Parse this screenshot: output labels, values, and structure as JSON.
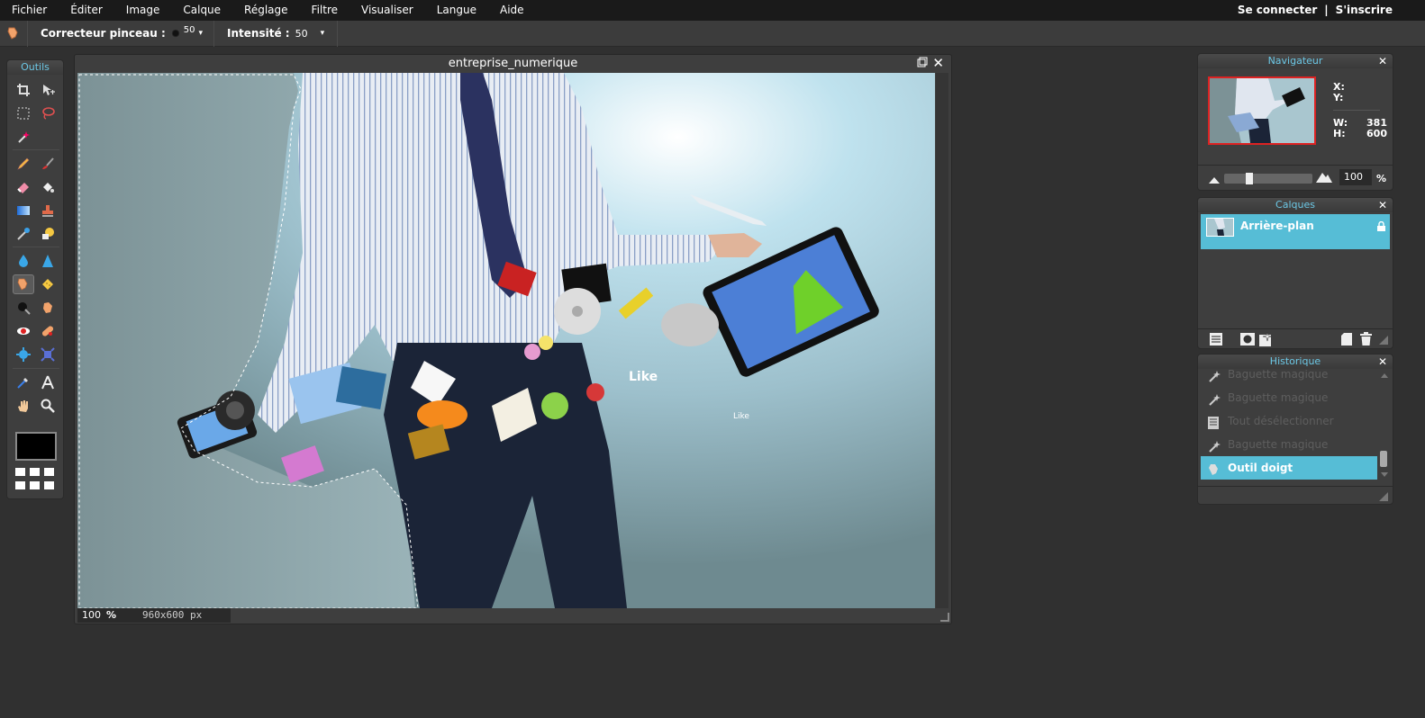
{
  "menu": {
    "items": [
      "Fichier",
      "Éditer",
      "Image",
      "Calque",
      "Réglage",
      "Filtre",
      "Visualiser",
      "Langue",
      "Aide"
    ],
    "login": "Se connecter",
    "separator": "|",
    "signup": "S'inscrire"
  },
  "options": {
    "tool_icon": "smudge-finger-icon",
    "brush_label": "Correcteur pinceau :",
    "brush_size": "50",
    "intensity_label": "Intensité :",
    "intensity_value": "50"
  },
  "tools": {
    "title": "Outils",
    "active_tool": "smudge-tool",
    "foreground_color": "#000000"
  },
  "document": {
    "title": "entreprise_numerique",
    "zoom": "100",
    "zoom_unit": "%",
    "size": "960x600 px"
  },
  "navigator": {
    "title": "Navigateur",
    "x_label": "X:",
    "y_label": "Y:",
    "x_value": "",
    "y_value": "",
    "w_label": "W:",
    "w_value": "381",
    "h_label": "H:",
    "h_value": "600",
    "zoom": "100",
    "zoom_unit": "%"
  },
  "layers": {
    "title": "Calques",
    "items": [
      {
        "name": "Arrière-plan",
        "locked": true,
        "selected": true
      }
    ]
  },
  "history": {
    "title": "Historique",
    "items": [
      {
        "label": "Baguette magique",
        "icon": "magic-wand-icon",
        "active": false
      },
      {
        "label": "Baguette magique",
        "icon": "magic-wand-icon",
        "active": false
      },
      {
        "label": "Tout désélectionner",
        "icon": "deselect-icon",
        "active": false
      },
      {
        "label": "Baguette magique",
        "icon": "magic-wand-icon",
        "active": false
      },
      {
        "label": "Outil doigt",
        "icon": "smudge-finger-icon",
        "active": true
      }
    ]
  },
  "colors": {
    "accent": "#56bdd6",
    "panel_title": "#6cc8e6",
    "background": "#303030"
  }
}
